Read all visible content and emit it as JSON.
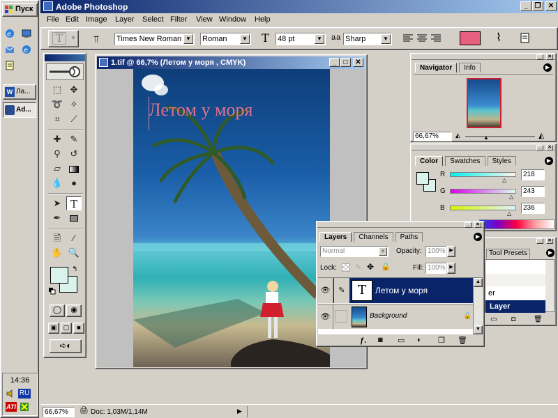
{
  "taskbar": {
    "start_label": "Пуск",
    "tasks": [
      "Ла...",
      "Ad..."
    ],
    "clock": "14:36",
    "lang": "RU"
  },
  "app": {
    "title": "Adobe Photoshop",
    "menu": [
      "File",
      "Edit",
      "Image",
      "Layer",
      "Select",
      "Filter",
      "View",
      "Window",
      "Help"
    ]
  },
  "options": {
    "font_family": "Times New Roman ...",
    "font_style": "Roman",
    "font_size": "48 pt",
    "aa_prefix": "a a",
    "antialias": "Sharp",
    "text_color": "#e8607f"
  },
  "document": {
    "title": "1.tif @ 66,7% (Летом у моря , CMYK)",
    "caption": "Летом у моря",
    "caption_color": "#e0728c"
  },
  "navigator": {
    "tabs": [
      "Navigator",
      "Info"
    ],
    "zoom": "66,67%"
  },
  "color": {
    "tabs": [
      "Color",
      "Swatches",
      "Styles"
    ],
    "channels": [
      {
        "label": "R",
        "value": "218"
      },
      {
        "label": "G",
        "value": "243"
      },
      {
        "label": "B",
        "value": "236"
      }
    ]
  },
  "layers": {
    "tabs": [
      "Layers",
      "Channels",
      "Paths"
    ],
    "blend_mode": "Normal",
    "opacity_label": "Opacity:",
    "opacity": "100%",
    "lock_label": "Lock:",
    "fill_label": "Fill:",
    "fill": "100%",
    "items": [
      {
        "name": "Летом у моря",
        "thumb": "T"
      },
      {
        "name": "Background",
        "thumb": ""
      }
    ]
  },
  "behind_panel": {
    "tool_presets_tab": "Tool Presets",
    "row_fragment": "er",
    "layer_label": "Layer"
  },
  "status": {
    "zoom": "66,67%",
    "doc": "Doc: 1,03M/1,14M"
  }
}
